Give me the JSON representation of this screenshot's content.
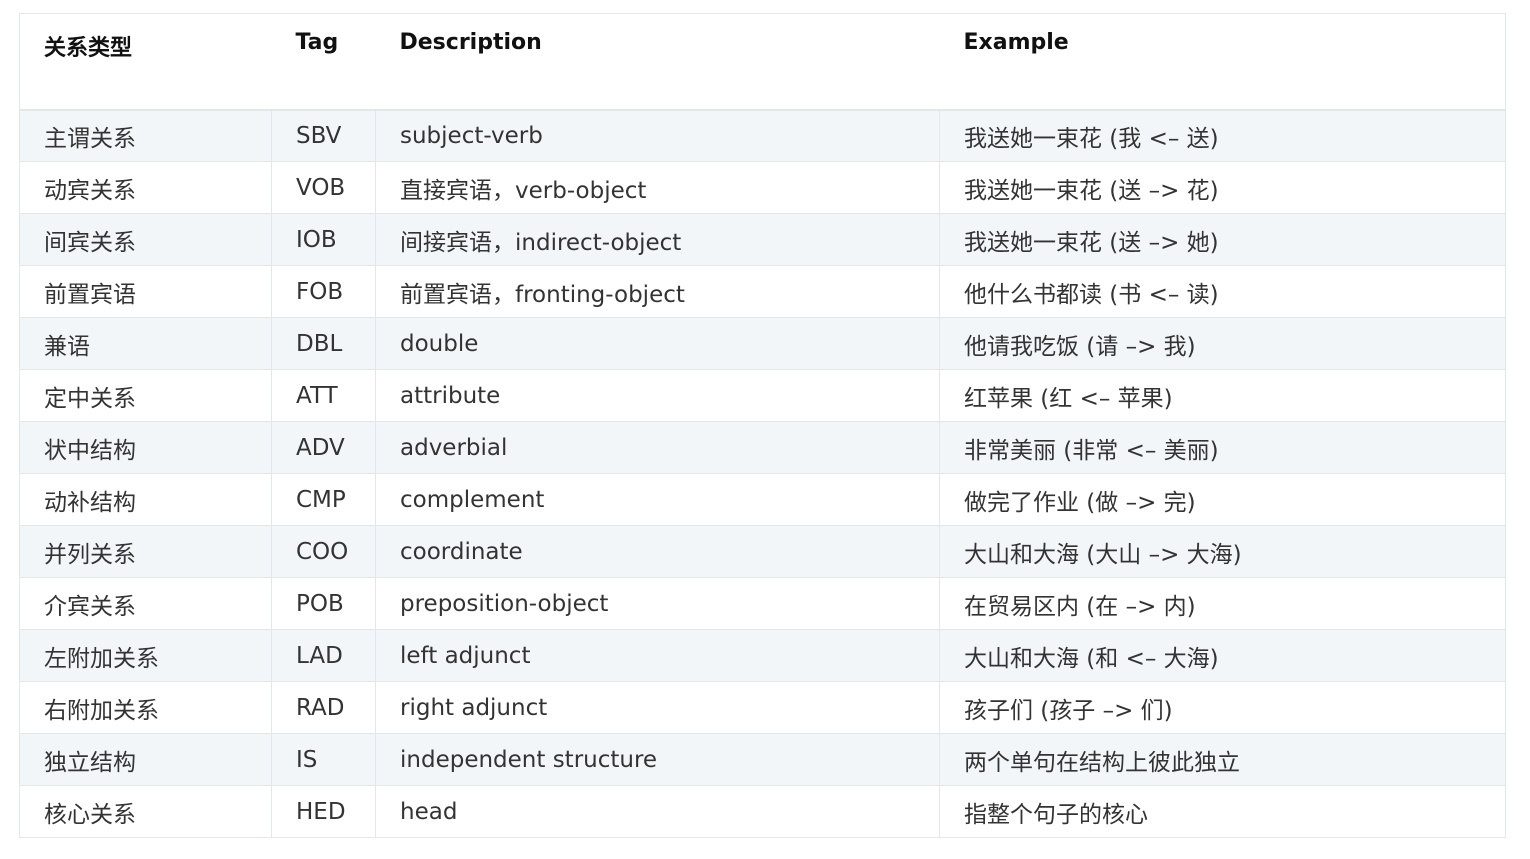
{
  "table": {
    "headers": [
      "关系类型",
      "Tag",
      "Description",
      "Example"
    ],
    "rows": [
      [
        "主谓关系",
        "SBV",
        "subject-verb",
        "我送她一束花 (我 <– 送)"
      ],
      [
        "动宾关系",
        "VOB",
        "直接宾语，verb-object",
        "我送她一束花 (送 –> 花)"
      ],
      [
        "间宾关系",
        "IOB",
        "间接宾语，indirect-object",
        "我送她一束花 (送 –> 她)"
      ],
      [
        "前置宾语",
        "FOB",
        "前置宾语，fronting-object",
        "他什么书都读 (书 <– 读)"
      ],
      [
        "兼语",
        "DBL",
        "double",
        "他请我吃饭 (请 –> 我)"
      ],
      [
        "定中关系",
        "ATT",
        "attribute",
        "红苹果 (红 <– 苹果)"
      ],
      [
        "状中结构",
        "ADV",
        "adverbial",
        "非常美丽 (非常 <– 美丽)"
      ],
      [
        "动补结构",
        "CMP",
        "complement",
        "做完了作业 (做 –> 完)"
      ],
      [
        "并列关系",
        "COO",
        "coordinate",
        "大山和大海 (大山 –> 大海)"
      ],
      [
        "介宾关系",
        "POB",
        "preposition-object",
        "在贸易区内 (在 –> 内)"
      ],
      [
        "左附加关系",
        "LAD",
        "left adjunct",
        "大山和大海 (和 <– 大海)"
      ],
      [
        "右附加关系",
        "RAD",
        "right adjunct",
        "孩子们 (孩子 –> 们)"
      ],
      [
        "独立结构",
        "IS",
        "independent structure",
        "两个单句在结构上彼此独立"
      ],
      [
        "核心关系",
        "HED",
        "head",
        "指整个句子的核心"
      ]
    ]
  }
}
